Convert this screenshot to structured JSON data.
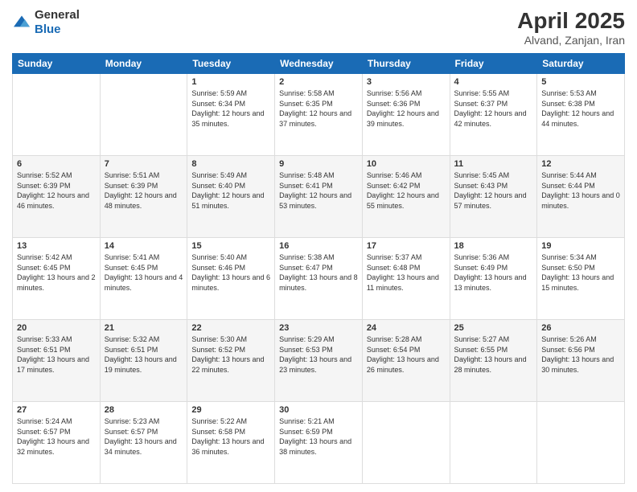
{
  "logo": {
    "general": "General",
    "blue": "Blue"
  },
  "title": {
    "month": "April 2025",
    "location": "Alvand, Zanjan, Iran"
  },
  "days_header": [
    "Sunday",
    "Monday",
    "Tuesday",
    "Wednesday",
    "Thursday",
    "Friday",
    "Saturday"
  ],
  "weeks": [
    [
      null,
      null,
      {
        "num": "1",
        "sunrise": "5:59 AM",
        "sunset": "6:34 PM",
        "daylight": "12 hours and 35 minutes."
      },
      {
        "num": "2",
        "sunrise": "5:58 AM",
        "sunset": "6:35 PM",
        "daylight": "12 hours and 37 minutes."
      },
      {
        "num": "3",
        "sunrise": "5:56 AM",
        "sunset": "6:36 PM",
        "daylight": "12 hours and 39 minutes."
      },
      {
        "num": "4",
        "sunrise": "5:55 AM",
        "sunset": "6:37 PM",
        "daylight": "12 hours and 42 minutes."
      },
      {
        "num": "5",
        "sunrise": "5:53 AM",
        "sunset": "6:38 PM",
        "daylight": "12 hours and 44 minutes."
      }
    ],
    [
      {
        "num": "6",
        "sunrise": "5:52 AM",
        "sunset": "6:39 PM",
        "daylight": "12 hours and 46 minutes."
      },
      {
        "num": "7",
        "sunrise": "5:51 AM",
        "sunset": "6:39 PM",
        "daylight": "12 hours and 48 minutes."
      },
      {
        "num": "8",
        "sunrise": "5:49 AM",
        "sunset": "6:40 PM",
        "daylight": "12 hours and 51 minutes."
      },
      {
        "num": "9",
        "sunrise": "5:48 AM",
        "sunset": "6:41 PM",
        "daylight": "12 hours and 53 minutes."
      },
      {
        "num": "10",
        "sunrise": "5:46 AM",
        "sunset": "6:42 PM",
        "daylight": "12 hours and 55 minutes."
      },
      {
        "num": "11",
        "sunrise": "5:45 AM",
        "sunset": "6:43 PM",
        "daylight": "12 hours and 57 minutes."
      },
      {
        "num": "12",
        "sunrise": "5:44 AM",
        "sunset": "6:44 PM",
        "daylight": "13 hours and 0 minutes."
      }
    ],
    [
      {
        "num": "13",
        "sunrise": "5:42 AM",
        "sunset": "6:45 PM",
        "daylight": "13 hours and 2 minutes."
      },
      {
        "num": "14",
        "sunrise": "5:41 AM",
        "sunset": "6:45 PM",
        "daylight": "13 hours and 4 minutes."
      },
      {
        "num": "15",
        "sunrise": "5:40 AM",
        "sunset": "6:46 PM",
        "daylight": "13 hours and 6 minutes."
      },
      {
        "num": "16",
        "sunrise": "5:38 AM",
        "sunset": "6:47 PM",
        "daylight": "13 hours and 8 minutes."
      },
      {
        "num": "17",
        "sunrise": "5:37 AM",
        "sunset": "6:48 PM",
        "daylight": "13 hours and 11 minutes."
      },
      {
        "num": "18",
        "sunrise": "5:36 AM",
        "sunset": "6:49 PM",
        "daylight": "13 hours and 13 minutes."
      },
      {
        "num": "19",
        "sunrise": "5:34 AM",
        "sunset": "6:50 PM",
        "daylight": "13 hours and 15 minutes."
      }
    ],
    [
      {
        "num": "20",
        "sunrise": "5:33 AM",
        "sunset": "6:51 PM",
        "daylight": "13 hours and 17 minutes."
      },
      {
        "num": "21",
        "sunrise": "5:32 AM",
        "sunset": "6:51 PM",
        "daylight": "13 hours and 19 minutes."
      },
      {
        "num": "22",
        "sunrise": "5:30 AM",
        "sunset": "6:52 PM",
        "daylight": "13 hours and 22 minutes."
      },
      {
        "num": "23",
        "sunrise": "5:29 AM",
        "sunset": "6:53 PM",
        "daylight": "13 hours and 23 minutes."
      },
      {
        "num": "24",
        "sunrise": "5:28 AM",
        "sunset": "6:54 PM",
        "daylight": "13 hours and 26 minutes."
      },
      {
        "num": "25",
        "sunrise": "5:27 AM",
        "sunset": "6:55 PM",
        "daylight": "13 hours and 28 minutes."
      },
      {
        "num": "26",
        "sunrise": "5:26 AM",
        "sunset": "6:56 PM",
        "daylight": "13 hours and 30 minutes."
      }
    ],
    [
      {
        "num": "27",
        "sunrise": "5:24 AM",
        "sunset": "6:57 PM",
        "daylight": "13 hours and 32 minutes."
      },
      {
        "num": "28",
        "sunrise": "5:23 AM",
        "sunset": "6:57 PM",
        "daylight": "13 hours and 34 minutes."
      },
      {
        "num": "29",
        "sunrise": "5:22 AM",
        "sunset": "6:58 PM",
        "daylight": "13 hours and 36 minutes."
      },
      {
        "num": "30",
        "sunrise": "5:21 AM",
        "sunset": "6:59 PM",
        "daylight": "13 hours and 38 minutes."
      },
      null,
      null,
      null
    ]
  ],
  "labels": {
    "sunrise": "Sunrise:",
    "sunset": "Sunset:",
    "daylight": "Daylight:"
  }
}
